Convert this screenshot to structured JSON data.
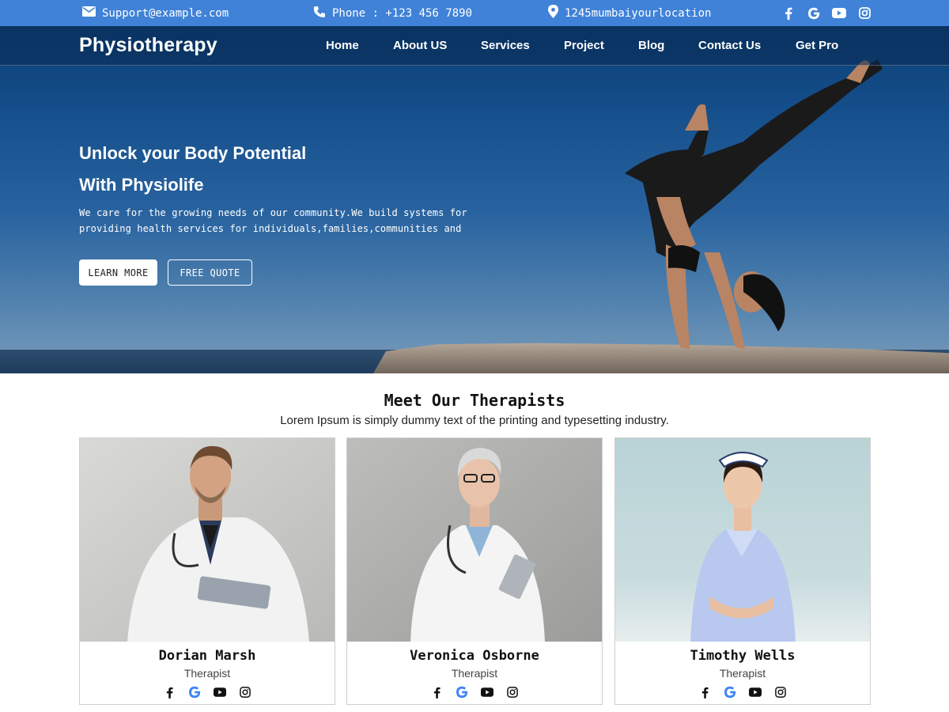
{
  "topbar": {
    "email": "Support@example.com",
    "phone": "Phone : +123 456 7890",
    "location": "1245mumbaiyourlocation"
  },
  "brand": "Physiotherapy",
  "nav": [
    "Home",
    "About US",
    "Services",
    "Project",
    "Blog",
    "Contact Us",
    "Get Pro"
  ],
  "hero": {
    "title_line1": "Unlock your Body Potential",
    "title_line2": "With Physiolife",
    "text_line1": "We care for the growing needs of our community.We build systems for",
    "text_line2": "providing health services for individuals,families,communities and",
    "btn_learn": "LEARN MORE",
    "btn_quote": "FREE QUOTE"
  },
  "therapists": {
    "title": "Meet Our Therapists",
    "subtitle": "Lorem Ipsum is simply dummy text of the printing and typesetting industry.",
    "cards": [
      {
        "name": "Dorian Marsh",
        "role": "Therapist"
      },
      {
        "name": "Veronica Osborne",
        "role": "Therapist"
      },
      {
        "name": "Timothy Wells",
        "role": "Therapist"
      }
    ]
  },
  "colors": {
    "topbar": "#3f82d8",
    "hero_dark": "#0d3f73",
    "google_blue": "#4285f4"
  },
  "icons": [
    "envelope-icon",
    "phone-icon",
    "map-pin-icon",
    "facebook-icon",
    "google-icon",
    "youtube-icon",
    "instagram-icon"
  ]
}
